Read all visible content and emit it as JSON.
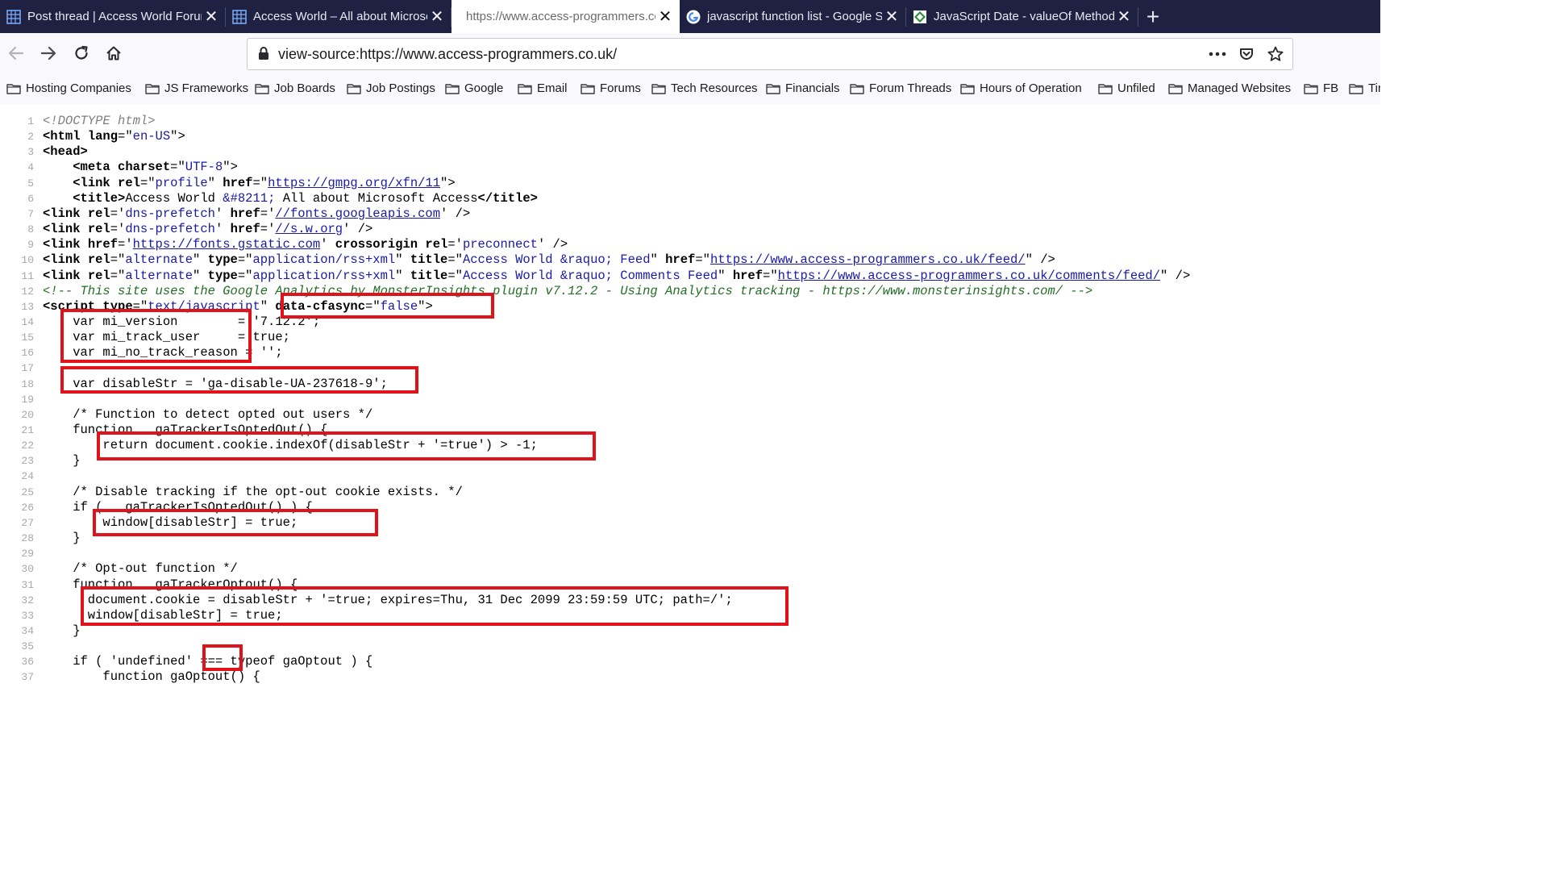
{
  "tabs": [
    {
      "title": "Post thread | Access World Forums",
      "icon": "grid-icon"
    },
    {
      "title": "Access World – All about Microsoft Access",
      "icon": "grid-icon"
    },
    {
      "title": "https://www.access-programmers.co.uk/",
      "icon": "",
      "active": true
    },
    {
      "title": "javascript function list - Google Search",
      "icon": "google-icon"
    },
    {
      "title": "JavaScript Date - valueOf Method",
      "icon": "diamond-icon"
    }
  ],
  "tab_close_glyph": "✕",
  "new_tab_glyph": "+",
  "url": "view-source:https://www.access-programmers.co.uk/",
  "bookmarks": [
    "Hosting Companies",
    "JS Frameworks",
    "Job Boards",
    "Job Postings",
    "Google",
    "Email",
    "Forums",
    "Tech Resources",
    "Financials",
    "Forum Threads",
    "Hours of Operation",
    "Unfiled",
    "Managed Websites",
    "FB",
    "Tir"
  ],
  "source_lines": [
    {
      "n": "1",
      "segs": [
        [
          "doctype",
          "<!DOCTYPE html>"
        ]
      ]
    },
    {
      "n": "2",
      "segs": [
        [
          "tagname",
          "<html "
        ],
        [
          "attr",
          "lang"
        ],
        [
          "plain",
          "=\""
        ],
        [
          "val",
          "en-US"
        ],
        [
          "plain",
          "\">"
        ]
      ]
    },
    {
      "n": "3",
      "segs": [
        [
          "tagname",
          "<head>"
        ]
      ]
    },
    {
      "n": "4",
      "segs": [
        [
          "plain",
          "    "
        ],
        [
          "tagname",
          "<meta "
        ],
        [
          "attr",
          "charset"
        ],
        [
          "plain",
          "=\""
        ],
        [
          "val",
          "UTF-8"
        ],
        [
          "plain",
          "\">"
        ]
      ]
    },
    {
      "n": "5",
      "segs": [
        [
          "plain",
          "    "
        ],
        [
          "tagname",
          "<link "
        ],
        [
          "attr",
          "rel"
        ],
        [
          "plain",
          "=\""
        ],
        [
          "val",
          "profile"
        ],
        [
          "plain",
          "\" "
        ],
        [
          "attr",
          "href"
        ],
        [
          "plain",
          "=\""
        ],
        [
          "link",
          "https://gmpg.org/xfn/11"
        ],
        [
          "plain",
          "\">"
        ]
      ]
    },
    {
      "n": "6",
      "segs": [
        [
          "plain",
          "    "
        ],
        [
          "tagname",
          "<title>"
        ],
        [
          "plain",
          "Access World "
        ],
        [
          "val",
          "&#8211;"
        ],
        [
          "plain",
          " All about Microsoft Access"
        ],
        [
          "tagname",
          "</title>"
        ]
      ]
    },
    {
      "n": "7",
      "segs": [
        [
          "tagname",
          "<link "
        ],
        [
          "attr",
          "rel"
        ],
        [
          "plain",
          "='"
        ],
        [
          "val",
          "dns-prefetch"
        ],
        [
          "plain",
          "' "
        ],
        [
          "attr",
          "href"
        ],
        [
          "plain",
          "='"
        ],
        [
          "link",
          "//fonts.googleapis.com"
        ],
        [
          "plain",
          "' />"
        ]
      ]
    },
    {
      "n": "8",
      "segs": [
        [
          "tagname",
          "<link "
        ],
        [
          "attr",
          "rel"
        ],
        [
          "plain",
          "='"
        ],
        [
          "val",
          "dns-prefetch"
        ],
        [
          "plain",
          "' "
        ],
        [
          "attr",
          "href"
        ],
        [
          "plain",
          "='"
        ],
        [
          "link",
          "//s.w.org"
        ],
        [
          "plain",
          "' />"
        ]
      ]
    },
    {
      "n": "9",
      "segs": [
        [
          "tagname",
          "<link "
        ],
        [
          "attr",
          "href"
        ],
        [
          "plain",
          "='"
        ],
        [
          "link",
          "https://fonts.gstatic.com"
        ],
        [
          "plain",
          "' "
        ],
        [
          "attr",
          "crossorigin "
        ],
        [
          "attr",
          "rel"
        ],
        [
          "plain",
          "='"
        ],
        [
          "val",
          "preconnect"
        ],
        [
          "plain",
          "' />"
        ]
      ]
    },
    {
      "n": "10",
      "segs": [
        [
          "tagname",
          "<link "
        ],
        [
          "attr",
          "rel"
        ],
        [
          "plain",
          "=\""
        ],
        [
          "val",
          "alternate"
        ],
        [
          "plain",
          "\" "
        ],
        [
          "attr",
          "type"
        ],
        [
          "plain",
          "=\""
        ],
        [
          "val",
          "application/rss+xml"
        ],
        [
          "plain",
          "\" "
        ],
        [
          "attr",
          "title"
        ],
        [
          "plain",
          "=\""
        ],
        [
          "val",
          "Access World &raquo; Feed"
        ],
        [
          "plain",
          "\" "
        ],
        [
          "attr",
          "href"
        ],
        [
          "plain",
          "=\""
        ],
        [
          "link",
          "https://www.access-programmers.co.uk/feed/"
        ],
        [
          "plain",
          "\" />"
        ]
      ]
    },
    {
      "n": "11",
      "segs": [
        [
          "tagname",
          "<link "
        ],
        [
          "attr",
          "rel"
        ],
        [
          "plain",
          "=\""
        ],
        [
          "val",
          "alternate"
        ],
        [
          "plain",
          "\" "
        ],
        [
          "attr",
          "type"
        ],
        [
          "plain",
          "=\""
        ],
        [
          "val",
          "application/rss+xml"
        ],
        [
          "plain",
          "\" "
        ],
        [
          "attr",
          "title"
        ],
        [
          "plain",
          "=\""
        ],
        [
          "val",
          "Access World &raquo; Comments Feed"
        ],
        [
          "plain",
          "\" "
        ],
        [
          "attr",
          "href"
        ],
        [
          "plain",
          "=\""
        ],
        [
          "link",
          "https://www.access-programmers.co.uk/comments/feed/"
        ],
        [
          "plain",
          "\" />"
        ]
      ]
    },
    {
      "n": "12",
      "segs": [
        [
          "comment",
          "<!-- This site uses the Google Analytics by MonsterInsights plugin v7.12.2 - Using Analytics tracking - https://www.monsterinsights.com/ -->"
        ]
      ]
    },
    {
      "n": "13",
      "segs": [
        [
          "tagname",
          "<script "
        ],
        [
          "attr",
          "type"
        ],
        [
          "plain",
          "=\""
        ],
        [
          "val",
          "text/javascript"
        ],
        [
          "plain",
          "\" "
        ],
        [
          "attr",
          "data-cfasync"
        ],
        [
          "plain",
          "=\""
        ],
        [
          "val",
          "false"
        ],
        [
          "plain",
          "\">"
        ]
      ]
    },
    {
      "n": "14",
      "segs": [
        [
          "plain",
          "    var mi_version        = '7.12.2';"
        ]
      ]
    },
    {
      "n": "15",
      "segs": [
        [
          "plain",
          "    var mi_track_user     = true;"
        ]
      ]
    },
    {
      "n": "16",
      "segs": [
        [
          "plain",
          "    var mi_no_track_reason = '';"
        ]
      ]
    },
    {
      "n": "17",
      "segs": [
        [
          "plain",
          ""
        ]
      ]
    },
    {
      "n": "18",
      "segs": [
        [
          "plain",
          "    var disableStr = 'ga-disable-UA-237618-9';"
        ]
      ]
    },
    {
      "n": "19",
      "segs": [
        [
          "plain",
          ""
        ]
      ]
    },
    {
      "n": "20",
      "segs": [
        [
          "plain",
          "    /* Function to detect opted out users */"
        ]
      ]
    },
    {
      "n": "21",
      "segs": [
        [
          "plain",
          "    function __gaTrackerIsOptedOut() {"
        ]
      ]
    },
    {
      "n": "22",
      "segs": [
        [
          "plain",
          "        return document.cookie.indexOf(disableStr + '=true') > -1;"
        ]
      ]
    },
    {
      "n": "23",
      "segs": [
        [
          "plain",
          "    }"
        ]
      ]
    },
    {
      "n": "24",
      "segs": [
        [
          "plain",
          ""
        ]
      ]
    },
    {
      "n": "25",
      "segs": [
        [
          "plain",
          "    /* Disable tracking if the opt-out cookie exists. */"
        ]
      ]
    },
    {
      "n": "26",
      "segs": [
        [
          "plain",
          "    if ( __gaTrackerIsOptedOut() ) {"
        ]
      ]
    },
    {
      "n": "27",
      "segs": [
        [
          "plain",
          "        window[disableStr] = true;"
        ]
      ]
    },
    {
      "n": "28",
      "segs": [
        [
          "plain",
          "    }"
        ]
      ]
    },
    {
      "n": "29",
      "segs": [
        [
          "plain",
          ""
        ]
      ]
    },
    {
      "n": "30",
      "segs": [
        [
          "plain",
          "    /* Opt-out function */"
        ]
      ]
    },
    {
      "n": "31",
      "segs": [
        [
          "plain",
          "    function __gaTrackerOptout() {"
        ]
      ]
    },
    {
      "n": "32",
      "segs": [
        [
          "plain",
          "      document.cookie = disableStr + '=true; expires=Thu, 31 Dec 2099 23:59:59 UTC; path=/';"
        ]
      ]
    },
    {
      "n": "33",
      "segs": [
        [
          "plain",
          "      window[disableStr] = true;"
        ]
      ]
    },
    {
      "n": "34",
      "segs": [
        [
          "plain",
          "    }"
        ]
      ]
    },
    {
      "n": "35",
      "segs": [
        [
          "plain",
          ""
        ]
      ]
    },
    {
      "n": "36",
      "segs": [
        [
          "plain",
          "    if ( 'undefined' === typeof gaOptout ) {"
        ]
      ]
    },
    {
      "n": "37",
      "segs": [
        [
          "plain",
          "        function gaOptout() {"
        ]
      ]
    }
  ],
  "annotation_color": "#e0131b"
}
